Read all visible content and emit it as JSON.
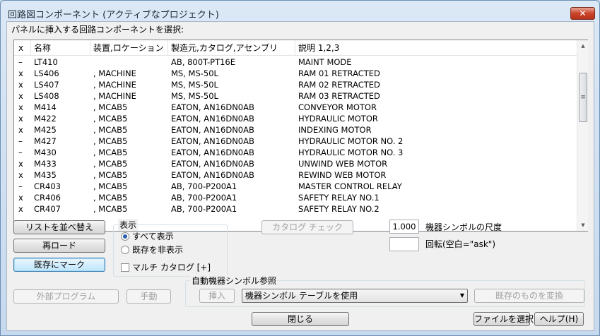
{
  "window": {
    "title": "回路図コンポーネント (アクティブなプロジェクト)",
    "close_label": "✕"
  },
  "prompt": "パネルに挿入する回路コンポーネントを選択:",
  "list": {
    "columns": [
      "x",
      "名称",
      "装置,ロケーション",
      "製造元,カタログ,アセンブリ",
      "説明 1,2,3"
    ],
    "rows": [
      [
        "–",
        "LT410",
        "",
        "AB, 800T-PT16E",
        "MAINT MODE"
      ],
      [
        "x",
        "LS406",
        ", MACHINE",
        "MS, MS-50L",
        "RAM 01 RETRACTED"
      ],
      [
        "x",
        "LS407",
        ", MACHINE",
        "MS, MS-50L",
        "RAM 02 RETRACTED"
      ],
      [
        "x",
        "LS408",
        ", MACHINE",
        "MS, MS-50L",
        "RAM 03 RETRACTED"
      ],
      [
        "x",
        "M414",
        ", MCAB5",
        "EATON, AN16DN0AB",
        "CONVEYOR MOTOR"
      ],
      [
        "x",
        "M422",
        ", MCAB5",
        "EATON, AN16DN0AB",
        "HYDRAULIC MOTOR"
      ],
      [
        "x",
        "M425",
        ", MCAB5",
        "EATON, AN16DN0AB",
        "INDEXING MOTOR"
      ],
      [
        "–",
        "M427",
        ", MCAB5",
        "EATON, AN16DN0AB",
        "HYDRAULIC MOTOR NO. 2"
      ],
      [
        "–",
        "M430",
        ", MCAB5",
        "EATON, AN16DN0AB",
        "HYDRAULIC MOTOR NO. 3"
      ],
      [
        "x",
        "M433",
        ", MCAB5",
        "EATON, AN16DN0AB",
        "UNWIND WEB MOTOR"
      ],
      [
        "x",
        "M435",
        ", MCAB5",
        "EATON, AN16DN0AB",
        "REWIND WEB MOTOR"
      ],
      [
        "–",
        "CR403",
        ", MCAB5",
        "AB, 700-P200A1",
        "MASTER CONTROL RELAY"
      ],
      [
        "x",
        "CR406",
        ", MCAB5",
        "AB, 700-P200A1",
        "SAFETY RELAY NO.1"
      ],
      [
        "x",
        "CR407",
        ", MCAB5",
        "AB, 700-P200A1",
        "SAFETY RELAY NO.2"
      ]
    ]
  },
  "buttons": {
    "sort_list": "リストを並べ替え",
    "reload": "再ロード",
    "mark_existing": "既存にマーク",
    "catalog_check": "カタログ チェック",
    "external_program": "外部プログラム",
    "manual": "手動",
    "insert": "挿入",
    "convert_existing": "既存のものを変換",
    "close": "閉じる",
    "select_file": "ファイルを選択",
    "help": "ヘルプ(H)"
  },
  "display_group": {
    "label": "表示",
    "show_all": "すべて表示",
    "hide_existing": "既存を非表示",
    "multi_catalog": "マルチ カタログ [+]"
  },
  "scale": {
    "value": "1.000",
    "label": "機器シンボルの尺度"
  },
  "rotation": {
    "value": "",
    "label": "回転(空白=\"ask\")"
  },
  "auto_group": {
    "label": "自動機器シンボル参照",
    "combo_value": "機器シンボル テーブルを使用"
  }
}
